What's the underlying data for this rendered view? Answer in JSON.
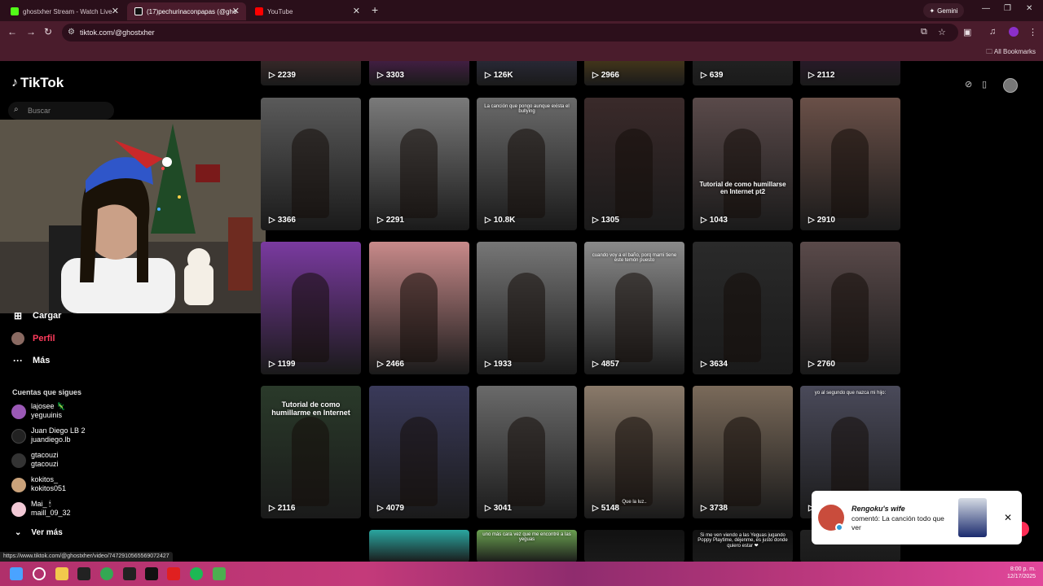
{
  "browser": {
    "tabs": [
      {
        "label": "ghostxher Stream - Watch Live",
        "fav_color": "#53fc18"
      },
      {
        "label": "(17)pechurinaconpapas (@gho",
        "fav_color": "#ffffff"
      },
      {
        "label": "YouTube",
        "fav_color": "#ff0000"
      }
    ],
    "new_tab": "+",
    "gemini_label": "Gemini",
    "url": "tiktok.com/@ghostxher",
    "all_bookmarks": "All Bookmarks"
  },
  "tiktok": {
    "logo_text": "TikTok",
    "search_placeholder": "Buscar",
    "nav": [
      {
        "label": "Cargar",
        "icon": "+"
      },
      {
        "label": "Perfil",
        "icon": "avatar"
      },
      {
        "label": "Más",
        "icon": "···"
      }
    ],
    "following_title": "Cuentas que sigues",
    "following": [
      {
        "name": "lajosee 🦎",
        "handle": "yeguuinis",
        "color": "#9b59b6"
      },
      {
        "name": "Juan Diego LB 2",
        "handle": "juandiego.lb",
        "color": "#222222"
      },
      {
        "name": "gtacouzi",
        "handle": "gtacouzi",
        "color": "#333333"
      },
      {
        "name": "kokitos_",
        "handle": "kokitos051",
        "color": "#caa27a"
      },
      {
        "name": "Mai_ 🕯",
        "handle": "maill_09_32",
        "color": "#f2c9d6"
      }
    ],
    "see_more": "Ver más"
  },
  "grid": {
    "row0": [
      "2239",
      "3303",
      "126K",
      "2966",
      "639",
      "2112"
    ],
    "row1": [
      "3366",
      "2291",
      "10.8K",
      "1305",
      "1043",
      "2910"
    ],
    "row2": [
      "1199",
      "2466",
      "1933",
      "4857",
      "3634",
      "2760"
    ],
    "row3": [
      "2116",
      "4079",
      "3041",
      "5148",
      "3738",
      "1"
    ],
    "captions": {
      "r1c2": "La canción que pongo aunque exista el bullying",
      "r1c4": "Tutorial de como humillarse en Internet pt2",
      "r2c3": "cuando voy a el baño, porq mami tiene este temón puesto",
      "r3c0": "Tutorial de como humillarme en Internet",
      "r3c3": "Que la luz..",
      "r3c5": "yo al segundo que nazca mi hijo:",
      "r4c2": "uno más cara vez que me encontré a las yeguas",
      "r4c4": "Si me ven viendo a las Yeguas jugando Poppy Playtime, déjenme, es justo donde quiero estar ❤"
    }
  },
  "notification": {
    "who": "Rengoku's wife",
    "message": "comentó: La canción todo que ver",
    "close": "✕"
  },
  "status_url": "https://www.tiktok.com/@ghostxher/video/7472910565569072427",
  "clock": {
    "time": "8:00 p. m.",
    "date": "12/17/2025"
  }
}
